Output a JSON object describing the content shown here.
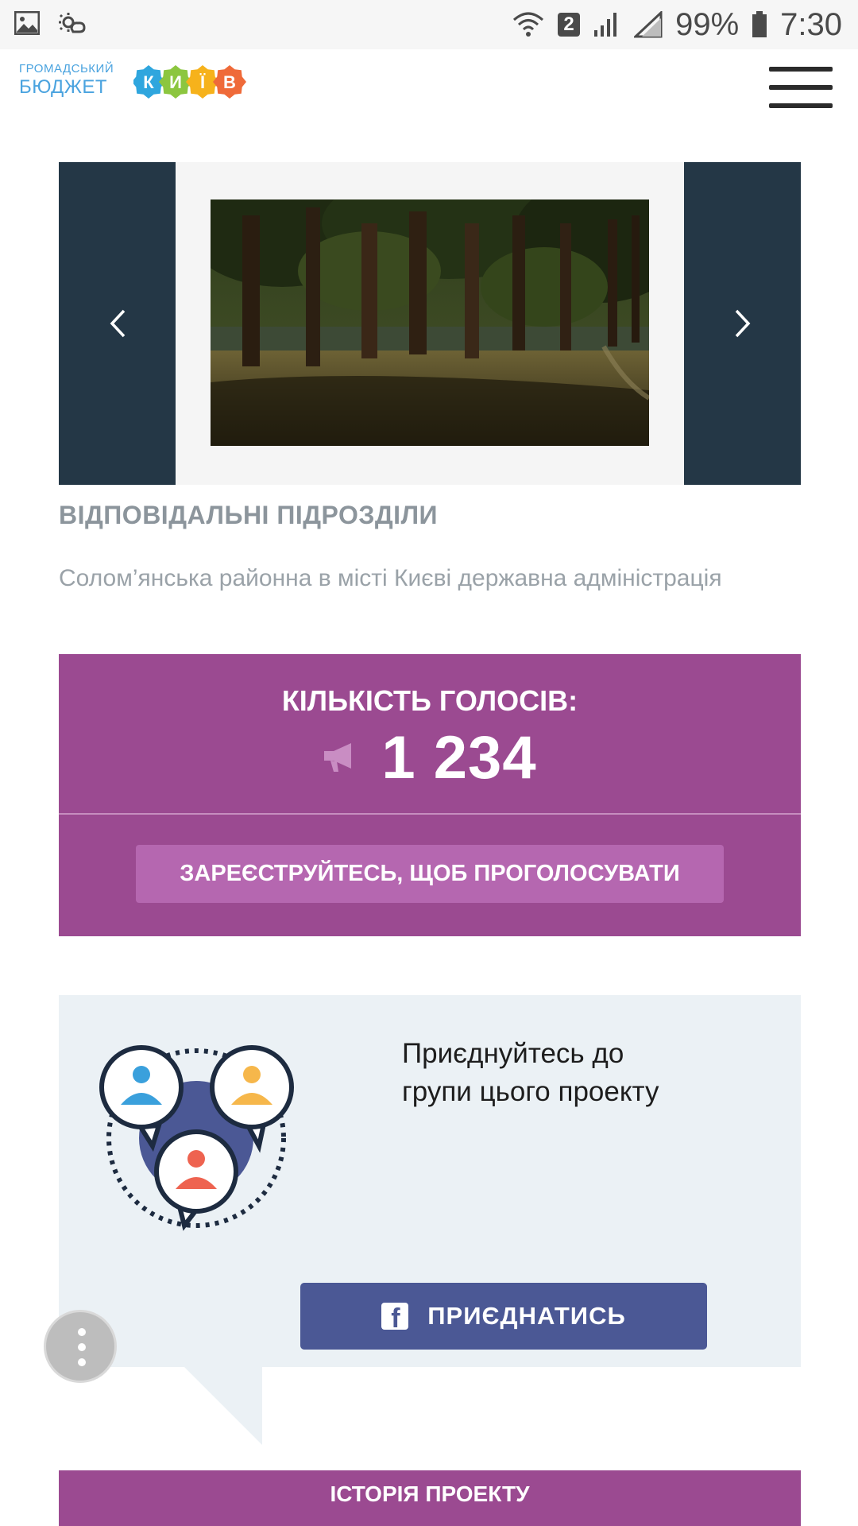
{
  "status_bar": {
    "left_icons": [
      "gallery-icon",
      "weather-icon"
    ],
    "sim_badge": "2",
    "battery": "99%",
    "time": "7:30"
  },
  "header": {
    "brand_top": "ГРОМАДСЬКИЙ",
    "brand_bottom": "БЮДЖЕТ",
    "logo_letters": [
      "К",
      "И",
      "Ї",
      "В"
    ],
    "logo_colors": [
      "#2fa6de",
      "#8cc63f",
      "#f6b21b",
      "#ef6a39"
    ],
    "menu_icon": "hamburger-icon"
  },
  "carousel": {
    "prev_icon": "chevron-left-icon",
    "next_icon": "chevron-right-icon"
  },
  "departments": {
    "title": "ВІДПОВІДАЛЬНІ ПІДРОЗДІЛИ",
    "text": "Солом’янська районна в місті Києві державна адміністрація"
  },
  "votes": {
    "label": "КІЛЬКІСТЬ ГОЛОСІВ:",
    "count": "1 234",
    "icon": "megaphone-icon",
    "register_button": "ЗАРЕЄСТРУЙТЕСЬ, ЩОБ ПРОГОЛОСУВАТИ"
  },
  "group": {
    "text": "Приєднуйтесь до групи цього проекту",
    "join_button": "ПРИЄДНАТИСЬ",
    "join_icon": "facebook-icon",
    "user_colors": [
      "#3aa0dc",
      "#f6b74b",
      "#ee6350"
    ]
  },
  "fab": {
    "icon": "more-vertical-icon"
  },
  "history": {
    "title": "ІСТОРІЯ ПРОЕКТУ"
  },
  "colors": {
    "accent_purple": "#9b4a91",
    "dark_nav": "#243746",
    "join_blue": "#4b5895"
  }
}
